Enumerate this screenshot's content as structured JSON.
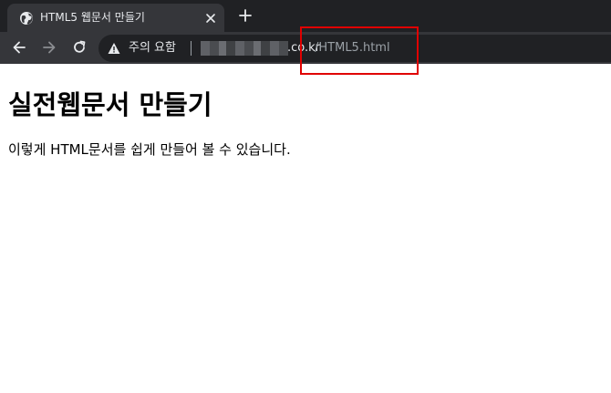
{
  "browser": {
    "tab": {
      "title": "HTML5 웹문서 만들기",
      "favicon": "globe-icon",
      "close_icon": "close-icon"
    },
    "new_tab_icon": "plus-icon",
    "nav": {
      "back_icon": "arrow-left-icon",
      "forward_icon": "arrow-right-icon",
      "reload_icon": "reload-icon"
    },
    "address_bar": {
      "security_icon": "warning-triangle-icon",
      "security_label": "주의 요함",
      "host_visible": ".co.kr",
      "path": "/HTML5.html"
    }
  },
  "annotation": {
    "highlight_color": "#e00000"
  },
  "page": {
    "heading": "실전웹문서 만들기",
    "paragraph": "이렇게 HTML문서를 쉽게 만들어 볼 수 있습니다."
  },
  "colors": {
    "tabstrip_bg": "#202124",
    "toolbar_bg": "#35363a",
    "omnibox_bg": "#202124",
    "chrome_text": "#e8eaed",
    "muted_text": "#9aa0a6"
  }
}
